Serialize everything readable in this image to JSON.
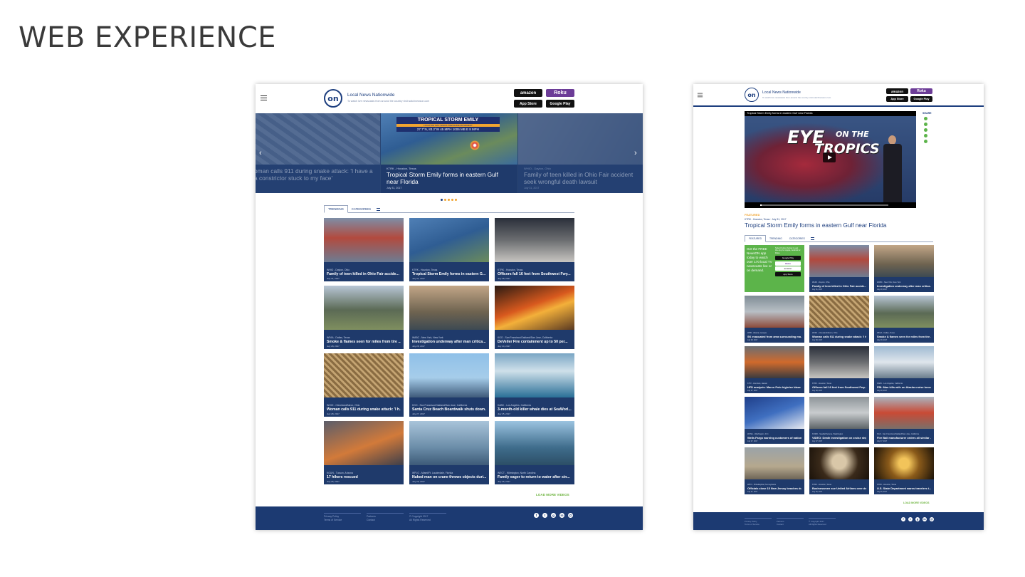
{
  "slide_title": "WEB EXPERIENCE",
  "colors": {
    "brand_navy": "#1d3e7e",
    "footer_navy": "#1c3a72",
    "accent_orange": "#f0a431",
    "accent_green": "#6fb441",
    "roku_purple": "#6c3c97"
  },
  "mock1": {
    "header": {
      "menu_icon": "hamburger-icon",
      "logo_text": "on",
      "brand_title": "Local News Nationwide",
      "brand_subtitle": "To watch live newscasts from around the country visit watchnewson.com",
      "stores": {
        "amazon": "amazon",
        "roku": "Roku",
        "appstore": "App Store",
        "googleplay": "Google Play"
      }
    },
    "hero": {
      "slides": [
        {
          "meta": "",
          "title": "oman calls 911 during snake attack: 'I have a\na constrictor stuck to my face'",
          "date": ""
        },
        {
          "meta": "KTRK - Houston, Texas",
          "title": "Tropical Storm Emily forms in eastern Gulf\nnear Florida",
          "date": "July 31, 2017"
        },
        {
          "meta": "WHIO - Dayton, Ohio",
          "title": "Family of teen killed in Ohio Fair accident\nseek wrongful death lawsuit",
          "date": "July 31, 2017"
        }
      ],
      "weather_banner": "TROPICAL STORM EMILY",
      "weather_stats": "27.7°N, 83.2°W   45 MPH   1006 MB   E 8 MPH",
      "weather_tags": "LOCATION   MAX WINDS   PRESSURE   MOVEMENT",
      "prev_arrow": "‹",
      "next_arrow": "›"
    },
    "tabs": [
      {
        "label": "TRENDING"
      },
      {
        "label": "CATEGORIES"
      }
    ],
    "cards": [
      {
        "meta": "WHIO - Dayton, Ohio",
        "title": "Family of teen killed in Ohio Fair accide...",
        "date": "July 31, 2017"
      },
      {
        "meta": "KTRK - Houston, Texas",
        "title": "Tropical Storm Emily forms in eastern G...",
        "date": "July 31, 2017"
      },
      {
        "meta": "KTRK - Houston, Texas",
        "title": "Officers fall 16 feet from Southwest Fwy...",
        "date": "July 28, 2017"
      },
      {
        "meta": "WFAA - Dallas, Texas",
        "title": "Smoke & flames seen for miles from tire ...",
        "date": "July 28, 2017"
      },
      {
        "meta": "WABC - New York, New York",
        "title": "Investigation underway after man critica...",
        "date": "July 28, 2017"
      },
      {
        "meta": "KGO - San Francisco/Oakland/San Jose, California",
        "title": "DeVeiler Fire containment up to 50 per...",
        "date": "July 24, 2017"
      },
      {
        "meta": "WOIO - Cleveland/Akron, Ohio",
        "title": "Woman calls 911 during snake attack: 'I h...",
        "date": "July 28, 2017"
      },
      {
        "meta": "KGO - San Francisco/Oakland/San Jose, California",
        "title": "Santa Cruz Beach Boardwalk shuts down...",
        "date": "July 27, 2017"
      },
      {
        "meta": "KABC - Los Angeles, California",
        "title": "3-month-old killer whale dies at SeaWorl...",
        "date": "July 25, 2017"
      },
      {
        "meta": "KGUN - Tucson, Arizona",
        "title": "17 hikers rescued",
        "date": "July 25, 2017"
      },
      {
        "meta": "WPLG - Miami/Ft. Lauderdale, Florida",
        "title": "Naked man on crane throws objects duri...",
        "date": "July 26, 2017"
      },
      {
        "meta": "WECT - Wilmington, North Carolina",
        "title": "Family eager to return to water after sin...",
        "date": "July 25, 2017"
      }
    ],
    "load_more": "LOAD MORE VIDEOS",
    "footer": {
      "col1": [
        "Privacy Policy",
        "Terms of Service"
      ],
      "col2": [
        "Partners",
        "Contact"
      ],
      "col3": [
        "© Copyright 2017",
        "All Rights Reserved"
      ],
      "social": [
        "f",
        "t",
        "g",
        "in",
        "@"
      ]
    }
  },
  "mock2": {
    "header": {
      "menu_icon": "hamburger-icon",
      "logo_text": "on",
      "brand_title": "Local News Nationwide",
      "brand_subtitle": "To watch live newscasts from around the country visit watchnewson.com",
      "stores": {
        "amazon": "amazon",
        "roku": "Roku",
        "appstore": "App Store",
        "googleplay": "Google Play"
      }
    },
    "player": {
      "top_title": "Tropical Storm Emily forms in eastern Gulf near Florida",
      "overlay_text_1": "EYE",
      "overlay_text_2": "ON THE",
      "overlay_text_3": "TROPICS",
      "progress": 0.01
    },
    "share_label": "SHARE",
    "featured_label": "FEATURED",
    "featured_meta": "KTRK - Houston, Texas  ·  July 31, 2017",
    "featured_title": "Tropical Storm Emily forms in eastern Gulf near Florida",
    "tabs": [
      {
        "label": "FEATURED"
      },
      {
        "label": "TRENDING"
      },
      {
        "label": "CATEGORIES"
      }
    ],
    "promo": {
      "text": "Get the FREE NewsON app today to watch over 170 local TV newscasts live or on demand.",
      "note": "Select button below to get the App for Apple, Android or Roku",
      "buttons": [
        "Google Play",
        "Roku",
        "amazon",
        "App Store"
      ]
    },
    "cards": [
      {
        "meta": "WHIO - Dayton, Ohio",
        "title": "Family of teen killed in Ohio Fair accide...",
        "date": "July 31, 2017"
      },
      {
        "meta": "WABC - New York, New York",
        "title": "Investigation underway after man critica...",
        "date": "July 28, 2017"
      },
      {
        "meta": "WSB - Atlanta, Georgia",
        "title": "SK evacuated from area surrounding ma...",
        "date": "July 28, 2017"
      },
      {
        "meta": "WOIO - Cleveland/Akron, Ohio",
        "title": "Woman calls 911 during snake attack: 'I h...",
        "date": "July 28, 2017"
      },
      {
        "meta": "WFAA - Dallas, Texas",
        "title": "Smoke & flames seen for miles from tire ...",
        "date": "July 28, 2017"
      },
      {
        "meta": "KITV - Honolulu, Hawaii",
        "title": "HFD analysis: Marco Polo highrise blaze ...",
        "date": "July 27, 2017"
      },
      {
        "meta": "KTRK - Houston, Texas",
        "title": "Officers fall 16 feet from Southwest Fwy...",
        "date": "July 28, 2017"
      },
      {
        "meta": "KABC - Los Angeles, California",
        "title": "FBI: Man kills wife on Alaska cruise beca...",
        "date": "July 28, 2017"
      },
      {
        "meta": "WUSA - Washington, D.C.",
        "title": "Wells Fargo warning customers of nation...",
        "date": "July 27, 2017"
      },
      {
        "meta": "KOMO - Seattle/Tacoma, Washington",
        "title": "VIDEO: Death investigation on cruise ship",
        "date": "July 27, 2017"
      },
      {
        "meta": "KGO - San Francisco/Oakland/San Jose, California",
        "title": "Fire Ball manufacturer orders all similar ...",
        "date": "July 27, 2017"
      },
      {
        "meta": "WPVI - Philadelphia, Pennsylvania",
        "title": "Officials close 15 New Jersey beaches du...",
        "date": "July 27, 2017"
      },
      {
        "meta": "KTRK - Houston, Texas",
        "title": "Businessmen sue United Airlines over de...",
        "date": "July 26, 2017"
      },
      {
        "meta": "KTRK - Houston, Texas",
        "title": "U.S. State Department warns travelers t...",
        "date": "July 26, 2017"
      }
    ],
    "load_more": "LOAD MORE VIDEOS",
    "footer": {
      "col1": [
        "Privacy Policy",
        "Terms of Service"
      ],
      "col2": [
        "Partners",
        "Contact"
      ],
      "col3": [
        "© Copyright 2017",
        "All Rights Reserved"
      ],
      "social": [
        "f",
        "t",
        "g",
        "in",
        "@"
      ]
    }
  }
}
